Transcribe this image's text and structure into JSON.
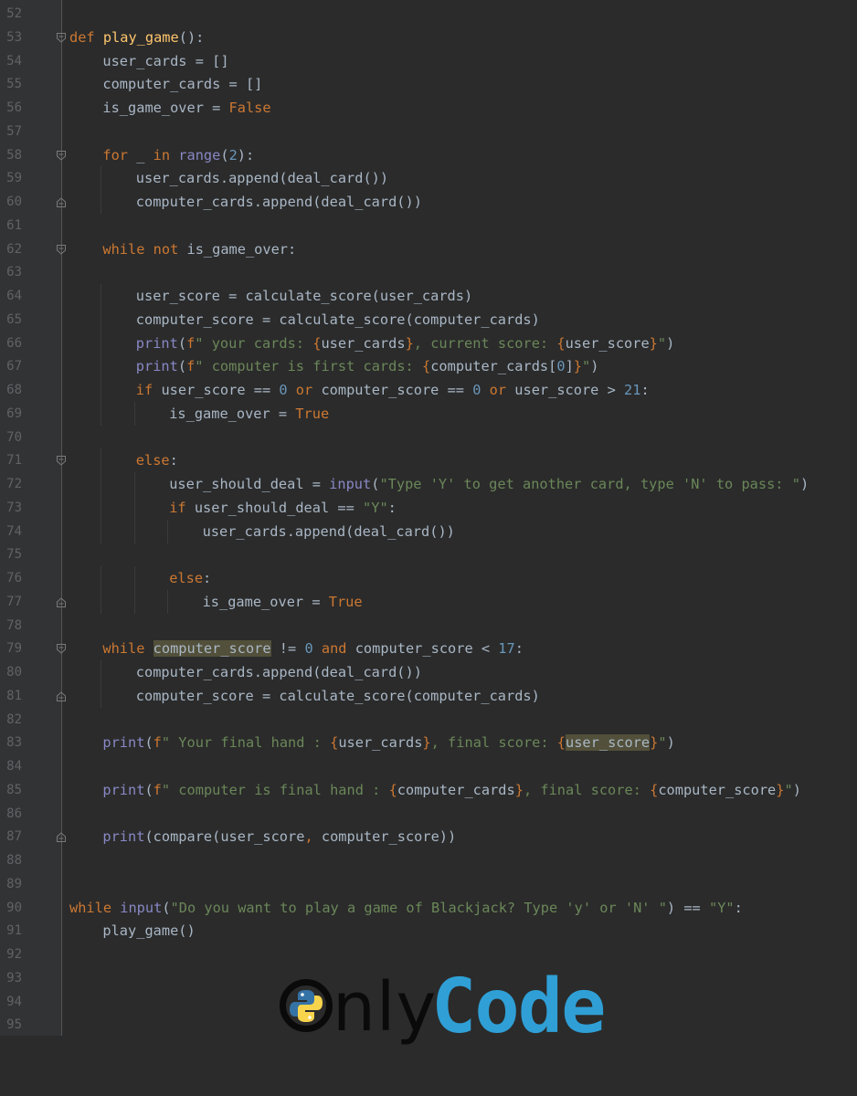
{
  "editor": {
    "language": "python",
    "lines": [
      {
        "n": "52",
        "fold": "",
        "indent": 0,
        "tokens": []
      },
      {
        "n": "53",
        "fold": "open",
        "indent": 0,
        "tokens": [
          [
            "kw",
            "def "
          ],
          [
            "fn",
            "play_game"
          ],
          [
            "",
            "():"
          ]
        ]
      },
      {
        "n": "54",
        "fold": "",
        "indent": 1,
        "tokens": [
          [
            "",
            "user_cards = []"
          ]
        ]
      },
      {
        "n": "55",
        "fold": "",
        "indent": 1,
        "tokens": [
          [
            "",
            "computer_cards = []"
          ]
        ]
      },
      {
        "n": "56",
        "fold": "",
        "indent": 1,
        "tokens": [
          [
            "",
            "is_game_over = "
          ],
          [
            "kw",
            "False"
          ]
        ]
      },
      {
        "n": "57",
        "fold": "",
        "indent": 0,
        "tokens": []
      },
      {
        "n": "58",
        "fold": "open",
        "indent": 1,
        "tokens": [
          [
            "kw",
            "for "
          ],
          [
            "",
            "_ "
          ],
          [
            "kw",
            "in "
          ],
          [
            "bi",
            "range"
          ],
          [
            "",
            "("
          ],
          [
            "num",
            "2"
          ],
          [
            "",
            "):"
          ]
        ]
      },
      {
        "n": "59",
        "fold": "",
        "indent": 2,
        "tokens": [
          [
            "",
            "user_cards.append(deal_card())"
          ]
        ]
      },
      {
        "n": "60",
        "fold": "close",
        "indent": 2,
        "tokens": [
          [
            "",
            "computer_cards.append(deal_card())"
          ]
        ]
      },
      {
        "n": "61",
        "fold": "",
        "indent": 0,
        "tokens": []
      },
      {
        "n": "62",
        "fold": "open",
        "indent": 1,
        "tokens": [
          [
            "kw",
            "while not "
          ],
          [
            "",
            "is_game_over:"
          ]
        ]
      },
      {
        "n": "63",
        "fold": "",
        "indent": 0,
        "tokens": []
      },
      {
        "n": "64",
        "fold": "",
        "indent": 2,
        "tokens": [
          [
            "",
            "user_score = calculate_score(user_cards)"
          ]
        ]
      },
      {
        "n": "65",
        "fold": "",
        "indent": 2,
        "tokens": [
          [
            "",
            "computer_score = calculate_score(computer_cards)"
          ]
        ]
      },
      {
        "n": "66",
        "fold": "",
        "indent": 2,
        "tokens": [
          [
            "bi",
            "print"
          ],
          [
            "",
            "("
          ],
          [
            "kw",
            "f"
          ],
          [
            "str",
            "\" your cards: "
          ],
          [
            "kw",
            "{"
          ],
          [
            "",
            "user_cards"
          ],
          [
            "kw",
            "}"
          ],
          [
            "str",
            ", current score: "
          ],
          [
            "kw",
            "{"
          ],
          [
            "",
            "user_score"
          ],
          [
            "kw",
            "}"
          ],
          [
            "str",
            "\""
          ],
          [
            "",
            ")"
          ]
        ]
      },
      {
        "n": "67",
        "fold": "",
        "indent": 2,
        "tokens": [
          [
            "bi",
            "print"
          ],
          [
            "",
            "("
          ],
          [
            "kw",
            "f"
          ],
          [
            "str",
            "\" computer is first cards: "
          ],
          [
            "kw",
            "{"
          ],
          [
            "",
            "computer_cards["
          ],
          [
            "num",
            "0"
          ],
          [
            "",
            "]"
          ],
          [
            "kw",
            "}"
          ],
          [
            "str",
            "\""
          ],
          [
            "",
            ")"
          ]
        ]
      },
      {
        "n": "68",
        "fold": "",
        "indent": 2,
        "tokens": [
          [
            "kw",
            "if "
          ],
          [
            "",
            "user_score == "
          ],
          [
            "num",
            "0"
          ],
          [
            "kw",
            " or "
          ],
          [
            "",
            "computer_score == "
          ],
          [
            "num",
            "0"
          ],
          [
            "kw",
            " or "
          ],
          [
            "",
            "user_score > "
          ],
          [
            "num",
            "21"
          ],
          [
            "",
            ":"
          ]
        ]
      },
      {
        "n": "69",
        "fold": "",
        "indent": 3,
        "tokens": [
          [
            "",
            "is_game_over = "
          ],
          [
            "kw",
            "True"
          ]
        ]
      },
      {
        "n": "70",
        "fold": "",
        "indent": 0,
        "tokens": []
      },
      {
        "n": "71",
        "fold": "open",
        "indent": 2,
        "tokens": [
          [
            "kw",
            "else"
          ],
          [
            "",
            ":"
          ]
        ]
      },
      {
        "n": "72",
        "fold": "",
        "indent": 3,
        "tokens": [
          [
            "",
            "user_should_deal = "
          ],
          [
            "bi",
            "input"
          ],
          [
            "",
            "("
          ],
          [
            "str",
            "\"Type 'Y' to get another card, type 'N' to pass: \""
          ],
          [
            "",
            ")"
          ]
        ]
      },
      {
        "n": "73",
        "fold": "",
        "indent": 3,
        "tokens": [
          [
            "kw",
            "if "
          ],
          [
            "",
            "user_should_deal == "
          ],
          [
            "str",
            "\"Y\""
          ],
          [
            "",
            ":"
          ]
        ]
      },
      {
        "n": "74",
        "fold": "",
        "indent": 4,
        "tokens": [
          [
            "",
            "user_cards.append(deal_card())"
          ]
        ]
      },
      {
        "n": "75",
        "fold": "",
        "indent": 0,
        "tokens": []
      },
      {
        "n": "76",
        "fold": "",
        "indent": 3,
        "tokens": [
          [
            "kw",
            "else"
          ],
          [
            "",
            ":"
          ]
        ]
      },
      {
        "n": "77",
        "fold": "close",
        "indent": 4,
        "tokens": [
          [
            "",
            "is_game_over = "
          ],
          [
            "kw",
            "True"
          ]
        ]
      },
      {
        "n": "78",
        "fold": "",
        "indent": 0,
        "tokens": []
      },
      {
        "n": "79",
        "fold": "open",
        "indent": 1,
        "tokens": [
          [
            "kw",
            "while "
          ],
          [
            "hl",
            "computer_score"
          ],
          [
            "",
            " != "
          ],
          [
            "num",
            "0"
          ],
          [
            "kw",
            " and "
          ],
          [
            "",
            "computer_score < "
          ],
          [
            "num",
            "17"
          ],
          [
            "",
            ":"
          ]
        ]
      },
      {
        "n": "80",
        "fold": "",
        "indent": 2,
        "tokens": [
          [
            "",
            "computer_cards.append(deal_card())"
          ]
        ]
      },
      {
        "n": "81",
        "fold": "close",
        "indent": 2,
        "tokens": [
          [
            "",
            "computer_score = calculate_score(computer_cards)"
          ]
        ]
      },
      {
        "n": "82",
        "fold": "",
        "indent": 0,
        "tokens": []
      },
      {
        "n": "83",
        "fold": "",
        "indent": 1,
        "tokens": [
          [
            "bi",
            "print"
          ],
          [
            "",
            "("
          ],
          [
            "kw",
            "f"
          ],
          [
            "str",
            "\" Your final hand : "
          ],
          [
            "kw",
            "{"
          ],
          [
            "",
            "user_cards"
          ],
          [
            "kw",
            "}"
          ],
          [
            "str",
            ", final score: "
          ],
          [
            "kw",
            "{"
          ],
          [
            "hl",
            "user_score"
          ],
          [
            "kw",
            "}"
          ],
          [
            "str",
            "\""
          ],
          [
            "",
            ")"
          ]
        ]
      },
      {
        "n": "84",
        "fold": "",
        "indent": 0,
        "tokens": []
      },
      {
        "n": "85",
        "fold": "",
        "indent": 1,
        "tokens": [
          [
            "bi",
            "print"
          ],
          [
            "",
            "("
          ],
          [
            "kw",
            "f"
          ],
          [
            "str",
            "\" computer is final hand : "
          ],
          [
            "kw",
            "{"
          ],
          [
            "",
            "computer_cards"
          ],
          [
            "kw",
            "}"
          ],
          [
            "str",
            ", final score: "
          ],
          [
            "kw",
            "{"
          ],
          [
            "",
            "computer_score"
          ],
          [
            "kw",
            "}"
          ],
          [
            "str",
            "\""
          ],
          [
            "",
            ")"
          ]
        ]
      },
      {
        "n": "86",
        "fold": "",
        "indent": 0,
        "tokens": []
      },
      {
        "n": "87",
        "fold": "close",
        "indent": 1,
        "tokens": [
          [
            "bi",
            "print"
          ],
          [
            "",
            "(compare(user_score"
          ],
          [
            "kw",
            ", "
          ],
          [
            "",
            "computer_score))"
          ]
        ]
      },
      {
        "n": "88",
        "fold": "",
        "indent": 0,
        "tokens": []
      },
      {
        "n": "89",
        "fold": "",
        "indent": 0,
        "tokens": []
      },
      {
        "n": "90",
        "fold": "",
        "indent": 0,
        "tokens": [
          [
            "kw",
            "while "
          ],
          [
            "bi",
            "input"
          ],
          [
            "",
            "("
          ],
          [
            "str",
            "\"Do you want to play a game of Blackjack? Type 'y' or 'N' \""
          ],
          [
            "",
            ") == "
          ],
          [
            "str",
            "\"Y\""
          ],
          [
            "",
            ":"
          ]
        ]
      },
      {
        "n": "91",
        "fold": "",
        "indent": 1,
        "tokens": [
          [
            "",
            "play_game()"
          ]
        ]
      },
      {
        "n": "92",
        "fold": "",
        "indent": 0,
        "tokens": []
      },
      {
        "n": "93",
        "fold": "",
        "indent": 0,
        "tokens": []
      },
      {
        "n": "94",
        "fold": "",
        "indent": 0,
        "tokens": []
      },
      {
        "n": "95",
        "fold": "",
        "indent": 0,
        "tokens": []
      }
    ]
  },
  "watermark": {
    "part1": "nly",
    "part2": "Code",
    "accent": "#2f9fd6",
    "icon": "python-logo-icon"
  },
  "colors": {
    "background": "#2b2b2b",
    "keyword": "#cc7832",
    "function": "#ffc66d",
    "builtin": "#8888c6",
    "number": "#6897bb",
    "string": "#6a8759",
    "text": "#a9b7c6"
  }
}
